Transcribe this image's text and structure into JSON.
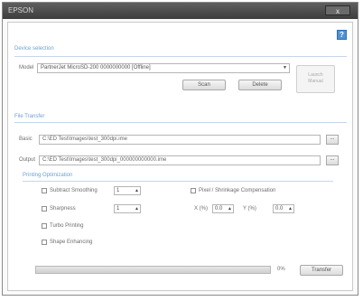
{
  "window": {
    "title": "EPSON",
    "close_label": "x"
  },
  "help_label": "?",
  "device_select": {
    "section_label": "Device selection",
    "model_label": "Model",
    "model_value": "PartnerJet   MicroSD-200   0000000000   [Offline]",
    "scan_label": "Scan",
    "delete_label": "Delete",
    "launch_label_line1": "Launch",
    "launch_label_line2": "Manual"
  },
  "file_transfer": {
    "section_label": "File Transfer",
    "basic_label": "Basic",
    "basic_value": "C:\\ED Test\\Images\\test_300dpi.ime",
    "output_label": "Output",
    "output_value": "C:\\ED Test\\Images\\test_300dpi_000000000000.ime",
    "browse_label": "..."
  },
  "printing_opt": {
    "section_label": "Printing Optimization",
    "options": [
      {
        "label": "Subtract Smoothing",
        "checked": false,
        "value": "1"
      },
      {
        "label": "Sharpness",
        "checked": false,
        "value": "1"
      },
      {
        "label": "Turbo Printing",
        "checked": false
      },
      {
        "label": "Shape Enhancing",
        "checked": false
      }
    ],
    "pixel_label": "Pixel / Shrinkage Compensation",
    "x_label": "X (%)",
    "x_value": "0.0",
    "y_label": "Y (%)",
    "y_value": "0.0"
  },
  "progress": {
    "percent_value": 0,
    "percent_text": "0%",
    "transfer_label": "Transfer"
  }
}
